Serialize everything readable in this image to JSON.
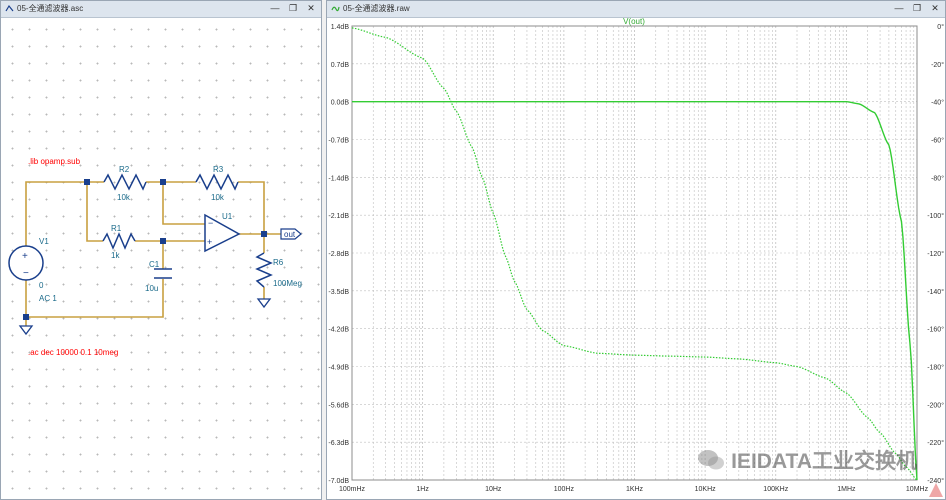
{
  "schematic": {
    "title": "05-全通滤波器.asc",
    "directive_lib": ".lib opamp.sub",
    "directive_ac": ".ac dec 10000 0.1 10meg",
    "components": {
      "r2_name": "R2",
      "r2_value": "10k",
      "r3_name": "R3",
      "r3_value": "10k",
      "r1_name": "R1",
      "r1_value": "1k",
      "c1_name": "C1",
      "c1_value": "10u",
      "u1_name": "U1",
      "r6_name": "R6",
      "r6_value": "100Meg",
      "v1_name": "V1",
      "v1_dc": "0",
      "v1_ac": "AC 1",
      "out_label": "out"
    }
  },
  "plot": {
    "title": "05-全通滤波器.raw",
    "trace_label": "V(out)",
    "watermark": "IEIDATA工业交换机",
    "left_axis_ticks": [
      "1.4dB",
      "0.7dB",
      "0.0dB",
      "-0.7dB",
      "-1.4dB",
      "-2.1dB",
      "-2.8dB",
      "-3.5dB",
      "-4.2dB",
      "-4.9dB",
      "-5.6dB",
      "-6.3dB",
      "-7.0dB"
    ],
    "right_axis_ticks": [
      "0°",
      "-20°",
      "-40°",
      "-60°",
      "-80°",
      "-100°",
      "-120°",
      "-140°",
      "-160°",
      "-180°",
      "-200°",
      "-220°",
      "-240°"
    ],
    "x_axis_ticks": [
      "100mHz",
      "1Hz",
      "10Hz",
      "100Hz",
      "1KHz",
      "10KHz",
      "100KHz",
      "1MHz",
      "10MHz"
    ],
    "colors": {
      "trace": "#33cc33",
      "grid": "#bfbfbf",
      "wire": "#c8a040",
      "component": "#1a3f8c",
      "directive": "#ff0000",
      "label": "#1a6a8a"
    }
  },
  "chart_data": {
    "type": "line",
    "title": "V(out)",
    "xlabel": "",
    "ylabel": "",
    "x_scale": "log",
    "xlim": [
      0.1,
      10000000
    ],
    "ylim": [
      -7.0,
      1.4
    ],
    "y2lim": [
      -240,
      0
    ],
    "grid": true,
    "series": [
      {
        "name": "V(out)",
        "axis": "magnitude_dB",
        "style": "solid",
        "x": [
          0.1,
          1,
          10,
          100,
          1000,
          10000,
          100000,
          1000000,
          1500000,
          2500000,
          4000000,
          6000000,
          8000000,
          10000000
        ],
        "y": [
          0.0,
          0.0,
          0.0,
          0.0,
          0.0,
          0.0,
          0.0,
          0.0,
          -0.04,
          -0.2,
          -0.8,
          -2.2,
          -4.5,
          -7.0
        ]
      },
      {
        "name": "V(out)",
        "axis": "phase_deg",
        "style": "dotted",
        "x": [
          0.1,
          0.3,
          1,
          2,
          3,
          5,
          7,
          10,
          15,
          20,
          30,
          50,
          100,
          300,
          1000,
          3000,
          10000,
          30000,
          100000,
          200000,
          500000,
          1000000,
          2000000,
          3000000,
          5000000,
          7000000,
          10000000
        ],
        "y": [
          -1,
          -6,
          -17,
          -33,
          -45,
          -64,
          -80,
          -99,
          -122,
          -135,
          -150,
          -161,
          -169,
          -173,
          -174,
          -174.5,
          -175,
          -176,
          -178,
          -180,
          -186,
          -194,
          -207,
          -215,
          -226,
          -233,
          -240
        ]
      }
    ]
  }
}
